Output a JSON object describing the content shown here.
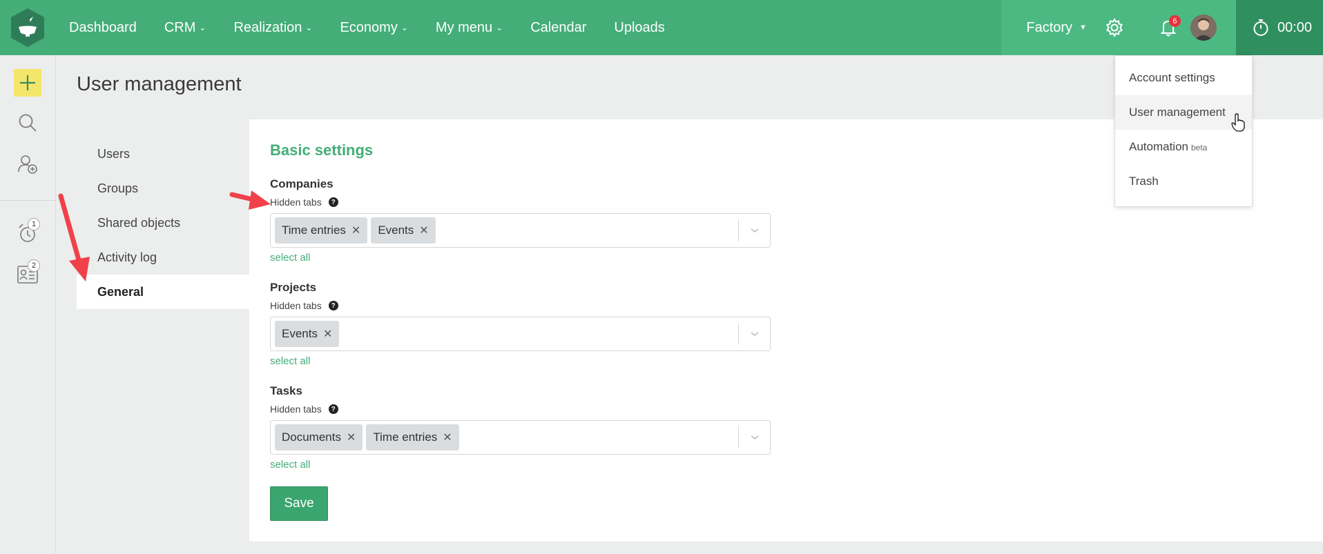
{
  "nav": {
    "items": [
      {
        "label": "Dashboard",
        "has_menu": false
      },
      {
        "label": "CRM",
        "has_menu": true
      },
      {
        "label": "Realization",
        "has_menu": true
      },
      {
        "label": "Economy",
        "has_menu": true
      },
      {
        "label": "My menu",
        "has_menu": true
      },
      {
        "label": "Calendar",
        "has_menu": false
      },
      {
        "label": "Uploads",
        "has_menu": false
      }
    ],
    "company": "Factory",
    "notifications_count": "6",
    "timer": "00:00"
  },
  "rail": {
    "reminders_count": "1",
    "tasks_count": "2"
  },
  "page_title": "User management",
  "submenu": {
    "items": [
      "Users",
      "Groups",
      "Shared objects",
      "Activity log",
      "General"
    ],
    "active": "General"
  },
  "settings": {
    "title": "Basic settings",
    "groups": [
      {
        "title": "Companies",
        "sub": "Hidden tabs",
        "tags": [
          "Time entries",
          "Events"
        ],
        "select_all": "select all"
      },
      {
        "title": "Projects",
        "sub": "Hidden tabs",
        "tags": [
          "Events"
        ],
        "select_all": "select all"
      },
      {
        "title": "Tasks",
        "sub": "Hidden tabs",
        "tags": [
          "Documents",
          "Time entries"
        ],
        "select_all": "select all"
      }
    ],
    "save_label": "Save"
  },
  "dropdown": {
    "items": [
      {
        "label": "Account settings",
        "suffix": ""
      },
      {
        "label": "User management",
        "suffix": ""
      },
      {
        "label": "Automation",
        "suffix": "beta"
      },
      {
        "label": "Trash",
        "suffix": ""
      }
    ],
    "hovered": "User management"
  },
  "colors": {
    "brand": "#44ad78",
    "highlight": "#f4e66a",
    "badge": "#e8323c",
    "annotation_arrow": "#f0414a"
  },
  "icons": [
    "logo-icon",
    "chevron-down-icon",
    "gear-icon",
    "bell-icon",
    "stopwatch-icon",
    "plus-icon",
    "search-icon",
    "add-contact-icon",
    "alarm-icon",
    "contact-card-icon",
    "question-icon",
    "close-icon",
    "pointer-cursor-icon",
    "red-arrow-icon"
  ]
}
